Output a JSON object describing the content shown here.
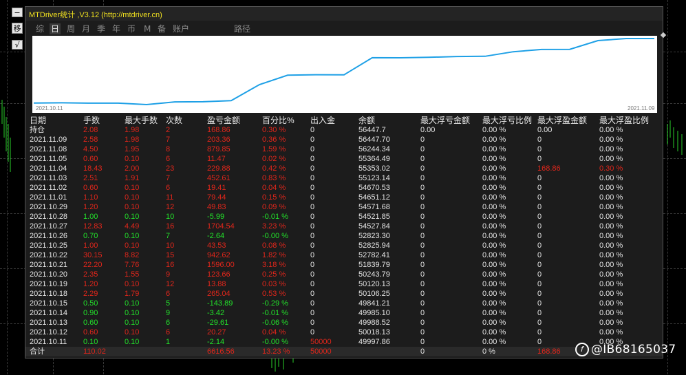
{
  "window": {
    "title": "MTDriver统计 ,V3.12 (http://mtdriver.cn)"
  },
  "side_buttons": {
    "minus": "−",
    "move": "移",
    "check": "√"
  },
  "tabs": [
    {
      "label": "综",
      "active": false
    },
    {
      "label": "日",
      "active": true
    },
    {
      "label": "周",
      "active": false
    },
    {
      "label": "月",
      "active": false
    },
    {
      "label": "季",
      "active": false
    },
    {
      "label": "年",
      "active": false
    },
    {
      "label": "币",
      "active": false
    },
    {
      "label": "M",
      "active": false
    },
    {
      "label": "备",
      "active": false
    },
    {
      "label": "账户",
      "active": false
    },
    {
      "label": "路径",
      "active": false
    }
  ],
  "chart_data": {
    "type": "line",
    "x_start_label": "2021.10.11",
    "x_end_label": "2021.11.09",
    "x": [
      "2021.10.11",
      "2021.10.12",
      "2021.10.13",
      "2021.10.14",
      "2021.10.15",
      "2021.10.18",
      "2021.10.19",
      "2021.10.20",
      "2021.10.21",
      "2021.10.22",
      "2021.10.25",
      "2021.10.26",
      "2021.10.27",
      "2021.10.28",
      "2021.10.29",
      "2021.11.01",
      "2021.11.02",
      "2021.11.03",
      "2021.11.04",
      "2021.11.05",
      "2021.11.08",
      "2021.11.09",
      "持仓"
    ],
    "series": [
      {
        "values": [
          49997.86,
          50018.13,
          49988.52,
          49985.1,
          49841.21,
          50106.25,
          50120.13,
          50243.79,
          51839.79,
          52782.41,
          52825.94,
          52823.3,
          54527.84,
          54521.85,
          54571.68,
          54651.12,
          54670.53,
          55123.14,
          55353.02,
          55364.49,
          56244.34,
          56447.7,
          56447.7
        ]
      }
    ],
    "color": "#1ea0e6"
  },
  "table": {
    "headers": [
      "日期",
      "手数",
      "最大手数",
      "次数",
      "盈亏金额",
      "百分比%",
      "出入金",
      "余额",
      "最大浮亏金额",
      "最大浮亏比例",
      "最大浮盈金额",
      "最大浮盈比例"
    ],
    "rows": [
      [
        "持仓",
        "2.08",
        "1.98",
        "2",
        "168.86",
        "0.30 %",
        "0",
        "56447.7",
        "0.00",
        "0.00 %",
        "0.00",
        "0.00 %"
      ],
      [
        "2021.11.09",
        "2.58",
        "1.98",
        "7",
        "203.36",
        "0.36 %",
        "0",
        "56447.70",
        "0",
        "0.00 %",
        "0",
        "0.00 %"
      ],
      [
        "2021.11.08",
        "4.50",
        "1.95",
        "8",
        "879.85",
        "1.59 %",
        "0",
        "56244.34",
        "0",
        "0.00 %",
        "0",
        "0.00 %"
      ],
      [
        "2021.11.05",
        "0.60",
        "0.10",
        "6",
        "11.47",
        "0.02 %",
        "0",
        "55364.49",
        "0",
        "0.00 %",
        "0",
        "0.00 %"
      ],
      [
        "2021.11.04",
        "18.43",
        "2.00",
        "23",
        "229.88",
        "0.42 %",
        "0",
        "55353.02",
        "0",
        "0.00 %",
        "168.86",
        "0.30 %"
      ],
      [
        "2021.11.03",
        "2.51",
        "1.91",
        "7",
        "452.61",
        "0.83 %",
        "0",
        "55123.14",
        "0",
        "0.00 %",
        "0",
        "0.00 %"
      ],
      [
        "2021.11.02",
        "0.60",
        "0.10",
        "6",
        "19.41",
        "0.04 %",
        "0",
        "54670.53",
        "0",
        "0.00 %",
        "0",
        "0.00 %"
      ],
      [
        "2021.11.01",
        "1.10",
        "0.10",
        "11",
        "79.44",
        "0.15 %",
        "0",
        "54651.12",
        "0",
        "0.00 %",
        "0",
        "0.00 %"
      ],
      [
        "2021.10.29",
        "1.20",
        "0.10",
        "12",
        "49.83",
        "0.09 %",
        "0",
        "54571.68",
        "0",
        "0.00 %",
        "0",
        "0.00 %"
      ],
      [
        "2021.10.28",
        "1.00",
        "0.10",
        "10",
        "-5.99",
        "-0.01 %",
        "0",
        "54521.85",
        "0",
        "0.00 %",
        "0",
        "0.00 %"
      ],
      [
        "2021.10.27",
        "12.83",
        "4.49",
        "16",
        "1704.54",
        "3.23 %",
        "0",
        "54527.84",
        "0",
        "0.00 %",
        "0",
        "0.00 %"
      ],
      [
        "2021.10.26",
        "0.70",
        "0.10",
        "7",
        "-2.64",
        "-0.00 %",
        "0",
        "52823.30",
        "0",
        "0.00 %",
        "0",
        "0.00 %"
      ],
      [
        "2021.10.25",
        "1.00",
        "0.10",
        "10",
        "43.53",
        "0.08 %",
        "0",
        "52825.94",
        "0",
        "0.00 %",
        "0",
        "0.00 %"
      ],
      [
        "2021.10.22",
        "30.15",
        "8.82",
        "15",
        "942.62",
        "1.82 %",
        "0",
        "52782.41",
        "0",
        "0.00 %",
        "0",
        "0.00 %"
      ],
      [
        "2021.10.21",
        "22.20",
        "7.76",
        "16",
        "1596.00",
        "3.18 %",
        "0",
        "51839.79",
        "0",
        "0.00 %",
        "0",
        "0.00 %"
      ],
      [
        "2021.10.20",
        "2.35",
        "1.55",
        "9",
        "123.66",
        "0.25 %",
        "0",
        "50243.79",
        "0",
        "0.00 %",
        "0",
        "0.00 %"
      ],
      [
        "2021.10.19",
        "1.20",
        "0.10",
        "12",
        "13.88",
        "0.03 %",
        "0",
        "50120.13",
        "0",
        "0.00 %",
        "0",
        "0.00 %"
      ],
      [
        "2021.10.18",
        "2.29",
        "1.79",
        "6",
        "265.04",
        "0.53 %",
        "0",
        "50106.25",
        "0",
        "0.00 %",
        "0",
        "0.00 %"
      ],
      [
        "2021.10.15",
        "0.50",
        "0.10",
        "5",
        "-143.89",
        "-0.29 %",
        "0",
        "49841.21",
        "0",
        "0.00 %",
        "0",
        "0.00 %"
      ],
      [
        "2021.10.14",
        "0.90",
        "0.10",
        "9",
        "-3.42",
        "-0.01 %",
        "0",
        "49985.10",
        "0",
        "0.00 %",
        "0",
        "0.00 %"
      ],
      [
        "2021.10.13",
        "0.60",
        "0.10",
        "6",
        "-29.61",
        "-0.06 %",
        "0",
        "49988.52",
        "0",
        "0.00 %",
        "0",
        "0.00 %"
      ],
      [
        "2021.10.12",
        "0.60",
        "0.10",
        "6",
        "20.27",
        "0.04 %",
        "0",
        "50018.13",
        "0",
        "0.00 %",
        "0",
        "0.00 %"
      ],
      [
        "2021.10.11",
        "0.10",
        "0.10",
        "1",
        "-2.14",
        "-0.00 %",
        "50000",
        "49997.86",
        "0",
        "0.00 %",
        "0",
        "0.00 %"
      ]
    ],
    "total": {
      "label": "合计",
      "lots": "110.02",
      "pnl": "6616.56",
      "pct": "13.23 %",
      "deposit": "50000",
      "float_loss": "0",
      "float_loss_pct": "0 %",
      "float_profit": "168.86"
    }
  },
  "watermark": {
    "text": "@IB68165037"
  },
  "colors": {
    "profit": "#e0261b",
    "loss": "#22e02a",
    "line": "#1ea0e6"
  }
}
